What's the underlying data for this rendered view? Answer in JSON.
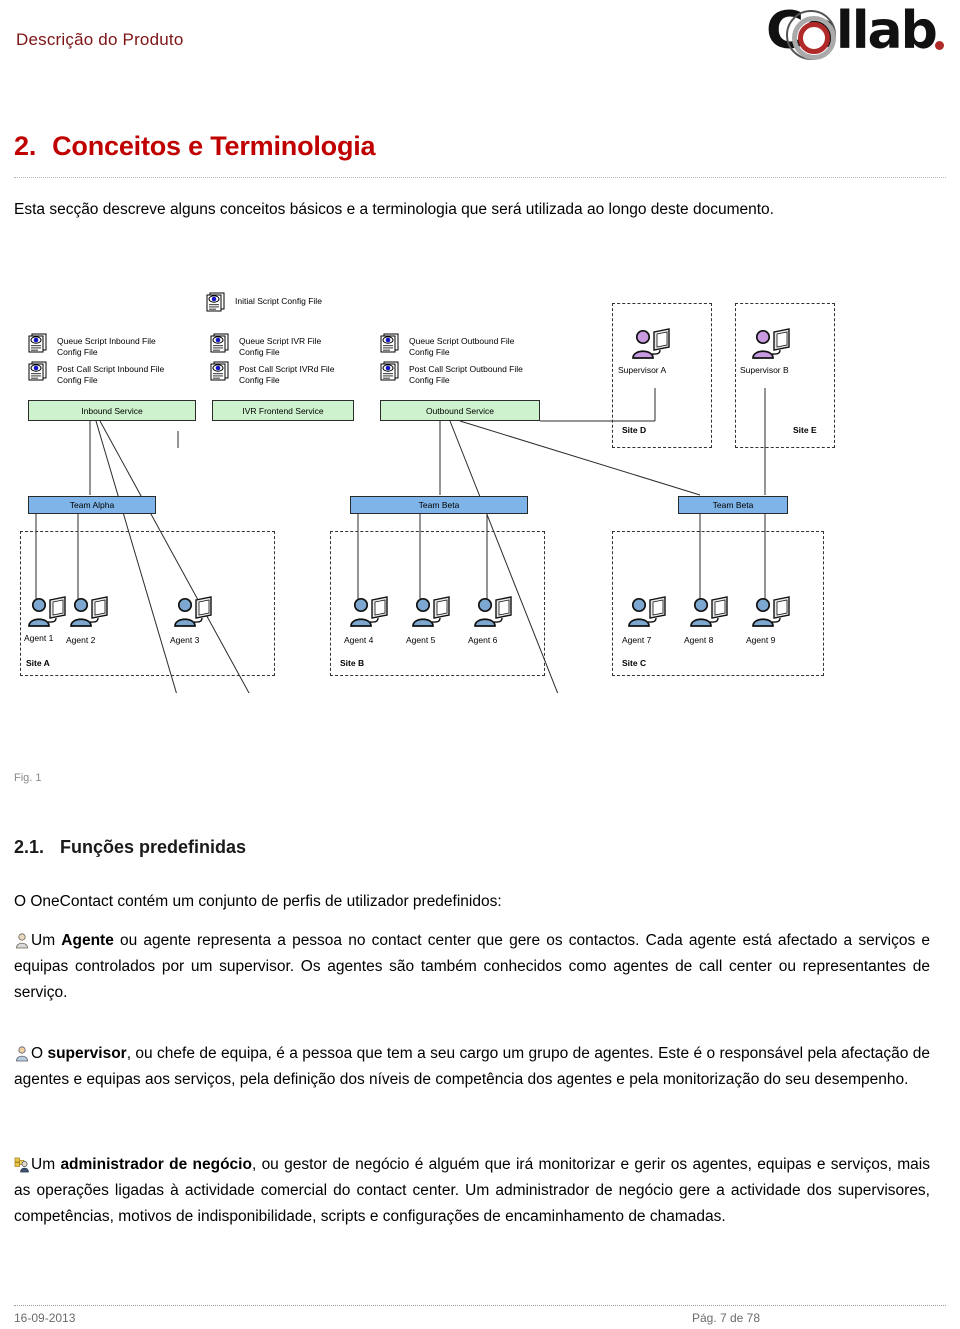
{
  "header": {
    "title": "Descrição do Produto",
    "logo_text": "Collab",
    "logo_name": "collab-logo"
  },
  "section": {
    "number": "2.",
    "title": "Conceitos e Terminologia",
    "intro": "Esta secção descreve alguns conceitos básicos e a terminologia que será utilizada ao longo deste documento."
  },
  "diagram": {
    "initial_script": {
      "line1": "Initial Script Config File"
    },
    "script_groups": [
      {
        "name": "inbound-scripts",
        "items": [
          {
            "line1": "Queue Script Inbound File",
            "line2": "Config File"
          },
          {
            "line1": "Post Call Script Inbound File",
            "line2": "Config File"
          }
        ]
      },
      {
        "name": "ivr-scripts",
        "items": [
          {
            "line1": "Queue Script IVR File",
            "line2": "Config File"
          },
          {
            "line1": "Post Call Script IVRd File",
            "line2": "Config File"
          }
        ]
      },
      {
        "name": "outbound-scripts",
        "items": [
          {
            "line1": "Queue Script Outbound File",
            "line2": "Config File"
          },
          {
            "line1": "Post Call Script Outbound File",
            "line2": "Config File"
          }
        ]
      }
    ],
    "services": [
      {
        "label": "Inbound Service"
      },
      {
        "label": "IVR Frontend Service"
      },
      {
        "label": "Outbound Service"
      }
    ],
    "teams": [
      {
        "label": "Team Alpha"
      },
      {
        "label": "Team Beta"
      },
      {
        "label": "Team Beta"
      }
    ],
    "supervisors": [
      {
        "label": "Supervisor A",
        "site": "Site D"
      },
      {
        "label": "Supervisor B",
        "site": "Site E"
      }
    ],
    "agent_sites": [
      {
        "site": "Site A",
        "agents": [
          "Agent 1",
          "Agent 2",
          "Agent 3"
        ]
      },
      {
        "site": "Site B",
        "agents": [
          "Agent 4",
          "Agent 5",
          "Agent 6"
        ]
      },
      {
        "site": "Site C",
        "agents": [
          "Agent 7",
          "Agent 8",
          "Agent 9"
        ]
      }
    ],
    "colors": {
      "service_fill": "#cdf2cd",
      "team_fill": "#7fb4e8",
      "supervisor_fill": "#c89ae0",
      "agent_fill": "#7ba7d0"
    },
    "caption": "Fig. 1"
  },
  "subsection": {
    "number": "2.1.",
    "title": "Funções predefinidas",
    "intro": "O OneContact contém um conjunto de perfis de utilizador predefinidos:"
  },
  "roles": [
    {
      "icon": "agent-icon",
      "lead": "Um ",
      "term": "Agente",
      "rest": " ou agente representa a pessoa no contact center que gere os contactos. Cada agente está afectado a serviços e equipas controlados por um supervisor. Os agentes são também conhecidos como agentes de call center ou representantes de serviço."
    },
    {
      "icon": "supervisor-icon",
      "lead": "O ",
      "term": "supervisor",
      "rest": ", ou chefe de equipa, é a pessoa que tem a seu cargo um grupo de agentes. Este é o responsável pela afectação de agentes e equipas aos serviços, pela definição dos níveis de competência dos agentes e pela monitorização do seu desempenho."
    },
    {
      "icon": "business-admin-icon",
      "lead": "Um ",
      "term": "administrador de negócio",
      "rest": ", ou gestor de negócio é alguém que irá monitorizar e gerir os agentes, equipas e serviços, mais as operações ligadas à actividade comercial do contact center. Um administrador de negócio gere a actividade dos supervisores, competências, motivos de indisponibilidade, scripts e configurações de encaminhamento de chamadas."
    }
  ],
  "footer": {
    "date": "16-09-2013",
    "page": "Pág. 7 de 78"
  }
}
